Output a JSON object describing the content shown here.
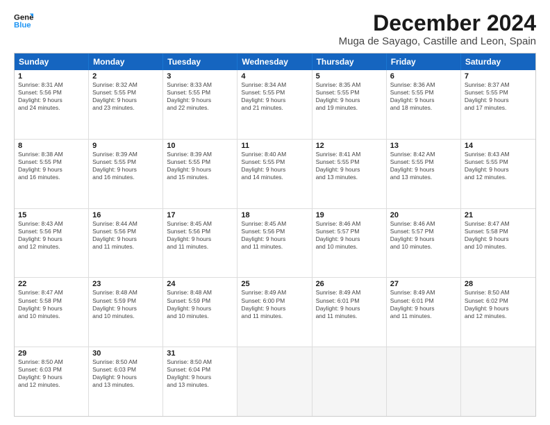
{
  "logo": {
    "line1": "General",
    "line2": "Blue"
  },
  "title": "December 2024",
  "subtitle": "Muga de Sayago, Castille and Leon, Spain",
  "header_days": [
    "Sunday",
    "Monday",
    "Tuesday",
    "Wednesday",
    "Thursday",
    "Friday",
    "Saturday"
  ],
  "weeks": [
    [
      {
        "num": "1",
        "lines": [
          "Sunrise: 8:31 AM",
          "Sunset: 5:56 PM",
          "Daylight: 9 hours",
          "and 24 minutes."
        ]
      },
      {
        "num": "2",
        "lines": [
          "Sunrise: 8:32 AM",
          "Sunset: 5:55 PM",
          "Daylight: 9 hours",
          "and 23 minutes."
        ]
      },
      {
        "num": "3",
        "lines": [
          "Sunrise: 8:33 AM",
          "Sunset: 5:55 PM",
          "Daylight: 9 hours",
          "and 22 minutes."
        ]
      },
      {
        "num": "4",
        "lines": [
          "Sunrise: 8:34 AM",
          "Sunset: 5:55 PM",
          "Daylight: 9 hours",
          "and 21 minutes."
        ]
      },
      {
        "num": "5",
        "lines": [
          "Sunrise: 8:35 AM",
          "Sunset: 5:55 PM",
          "Daylight: 9 hours",
          "and 19 minutes."
        ]
      },
      {
        "num": "6",
        "lines": [
          "Sunrise: 8:36 AM",
          "Sunset: 5:55 PM",
          "Daylight: 9 hours",
          "and 18 minutes."
        ]
      },
      {
        "num": "7",
        "lines": [
          "Sunrise: 8:37 AM",
          "Sunset: 5:55 PM",
          "Daylight: 9 hours",
          "and 17 minutes."
        ]
      }
    ],
    [
      {
        "num": "8",
        "lines": [
          "Sunrise: 8:38 AM",
          "Sunset: 5:55 PM",
          "Daylight: 9 hours",
          "and 16 minutes."
        ]
      },
      {
        "num": "9",
        "lines": [
          "Sunrise: 8:39 AM",
          "Sunset: 5:55 PM",
          "Daylight: 9 hours",
          "and 16 minutes."
        ]
      },
      {
        "num": "10",
        "lines": [
          "Sunrise: 8:39 AM",
          "Sunset: 5:55 PM",
          "Daylight: 9 hours",
          "and 15 minutes."
        ]
      },
      {
        "num": "11",
        "lines": [
          "Sunrise: 8:40 AM",
          "Sunset: 5:55 PM",
          "Daylight: 9 hours",
          "and 14 minutes."
        ]
      },
      {
        "num": "12",
        "lines": [
          "Sunrise: 8:41 AM",
          "Sunset: 5:55 PM",
          "Daylight: 9 hours",
          "and 13 minutes."
        ]
      },
      {
        "num": "13",
        "lines": [
          "Sunrise: 8:42 AM",
          "Sunset: 5:55 PM",
          "Daylight: 9 hours",
          "and 13 minutes."
        ]
      },
      {
        "num": "14",
        "lines": [
          "Sunrise: 8:43 AM",
          "Sunset: 5:55 PM",
          "Daylight: 9 hours",
          "and 12 minutes."
        ]
      }
    ],
    [
      {
        "num": "15",
        "lines": [
          "Sunrise: 8:43 AM",
          "Sunset: 5:56 PM",
          "Daylight: 9 hours",
          "and 12 minutes."
        ]
      },
      {
        "num": "16",
        "lines": [
          "Sunrise: 8:44 AM",
          "Sunset: 5:56 PM",
          "Daylight: 9 hours",
          "and 11 minutes."
        ]
      },
      {
        "num": "17",
        "lines": [
          "Sunrise: 8:45 AM",
          "Sunset: 5:56 PM",
          "Daylight: 9 hours",
          "and 11 minutes."
        ]
      },
      {
        "num": "18",
        "lines": [
          "Sunrise: 8:45 AM",
          "Sunset: 5:56 PM",
          "Daylight: 9 hours",
          "and 11 minutes."
        ]
      },
      {
        "num": "19",
        "lines": [
          "Sunrise: 8:46 AM",
          "Sunset: 5:57 PM",
          "Daylight: 9 hours",
          "and 10 minutes."
        ]
      },
      {
        "num": "20",
        "lines": [
          "Sunrise: 8:46 AM",
          "Sunset: 5:57 PM",
          "Daylight: 9 hours",
          "and 10 minutes."
        ]
      },
      {
        "num": "21",
        "lines": [
          "Sunrise: 8:47 AM",
          "Sunset: 5:58 PM",
          "Daylight: 9 hours",
          "and 10 minutes."
        ]
      }
    ],
    [
      {
        "num": "22",
        "lines": [
          "Sunrise: 8:47 AM",
          "Sunset: 5:58 PM",
          "Daylight: 9 hours",
          "and 10 minutes."
        ]
      },
      {
        "num": "23",
        "lines": [
          "Sunrise: 8:48 AM",
          "Sunset: 5:59 PM",
          "Daylight: 9 hours",
          "and 10 minutes."
        ]
      },
      {
        "num": "24",
        "lines": [
          "Sunrise: 8:48 AM",
          "Sunset: 5:59 PM",
          "Daylight: 9 hours",
          "and 10 minutes."
        ]
      },
      {
        "num": "25",
        "lines": [
          "Sunrise: 8:49 AM",
          "Sunset: 6:00 PM",
          "Daylight: 9 hours",
          "and 11 minutes."
        ]
      },
      {
        "num": "26",
        "lines": [
          "Sunrise: 8:49 AM",
          "Sunset: 6:01 PM",
          "Daylight: 9 hours",
          "and 11 minutes."
        ]
      },
      {
        "num": "27",
        "lines": [
          "Sunrise: 8:49 AM",
          "Sunset: 6:01 PM",
          "Daylight: 9 hours",
          "and 11 minutes."
        ]
      },
      {
        "num": "28",
        "lines": [
          "Sunrise: 8:50 AM",
          "Sunset: 6:02 PM",
          "Daylight: 9 hours",
          "and 12 minutes."
        ]
      }
    ],
    [
      {
        "num": "29",
        "lines": [
          "Sunrise: 8:50 AM",
          "Sunset: 6:03 PM",
          "Daylight: 9 hours",
          "and 12 minutes."
        ]
      },
      {
        "num": "30",
        "lines": [
          "Sunrise: 8:50 AM",
          "Sunset: 6:03 PM",
          "Daylight: 9 hours",
          "and 13 minutes."
        ]
      },
      {
        "num": "31",
        "lines": [
          "Sunrise: 8:50 AM",
          "Sunset: 6:04 PM",
          "Daylight: 9 hours",
          "and 13 minutes."
        ]
      },
      {
        "num": "",
        "lines": []
      },
      {
        "num": "",
        "lines": []
      },
      {
        "num": "",
        "lines": []
      },
      {
        "num": "",
        "lines": []
      }
    ]
  ]
}
